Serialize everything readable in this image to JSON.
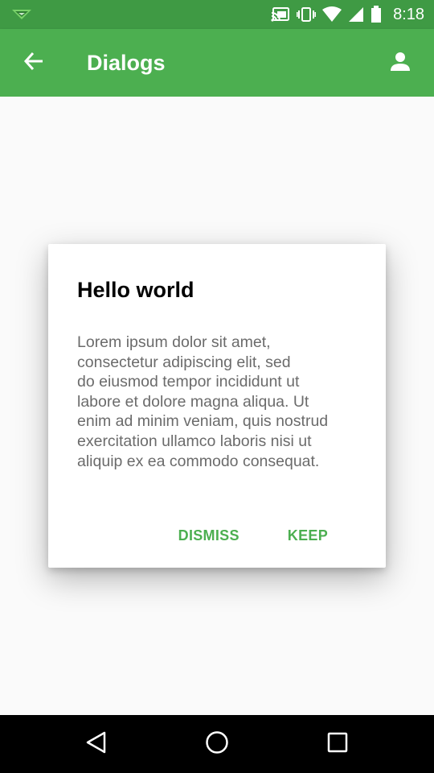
{
  "status_bar": {
    "time": "8:18",
    "icons": [
      "notification-icon",
      "cast-icon",
      "vibrate-icon",
      "wifi-icon",
      "signal-icon",
      "battery-icon"
    ]
  },
  "app_bar": {
    "title": "Dialogs",
    "background_color": "#4caf50",
    "status_color": "#3f9a44",
    "back_icon": "arrow-back-icon",
    "account_icon": "account-icon"
  },
  "dialog": {
    "title": "Hello world",
    "body": "Lorem ipsum dolor sit amet,\nconsectetur adipiscing elit, sed\ndo eiusmod tempor incididunt ut\nlabore et dolore magna aliqua. Ut\nenim ad minim veniam, quis nostrud\nexercitation ullamco laboris nisi ut\naliquip ex ea commodo consequat.",
    "dismiss_label": "DISMISS",
    "keep_label": "KEEP",
    "accent_color": "#4caf50"
  },
  "nav_bar": {
    "icons": [
      "nav-back-icon",
      "nav-home-icon",
      "nav-recents-icon"
    ]
  }
}
